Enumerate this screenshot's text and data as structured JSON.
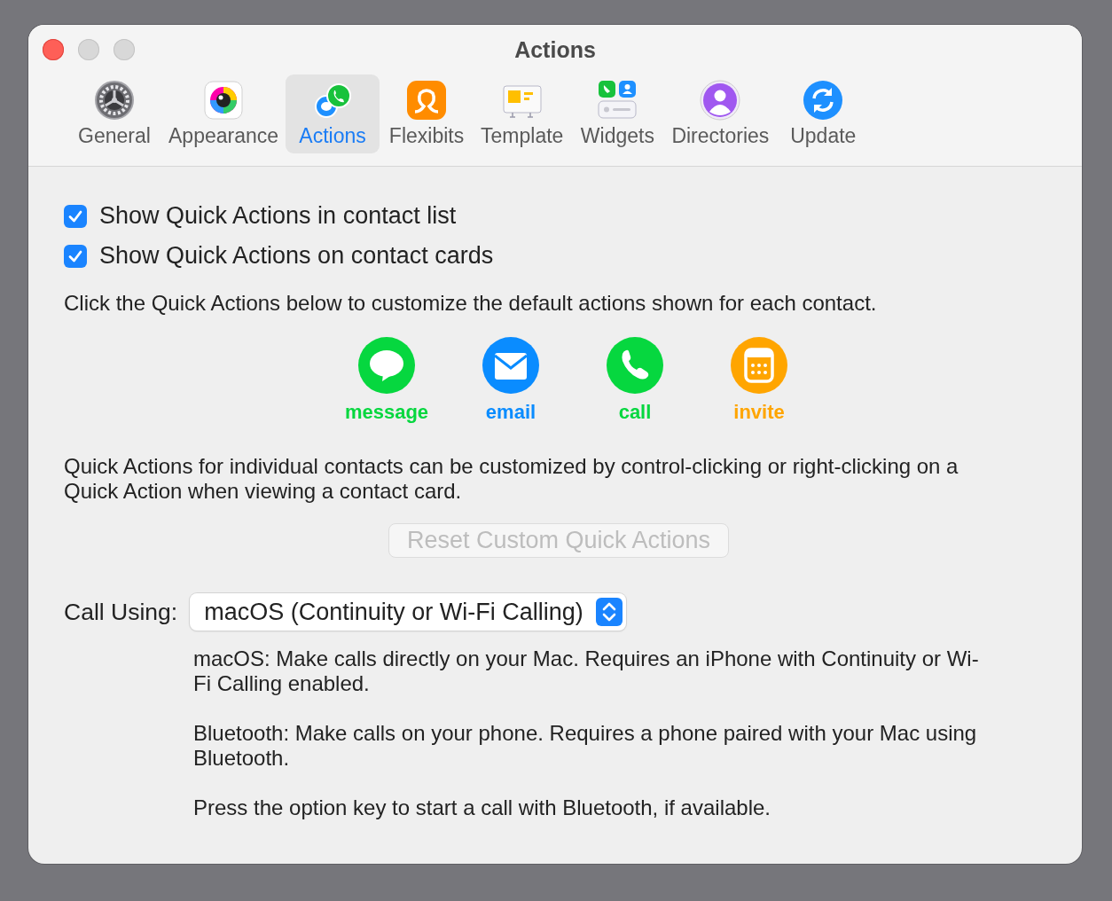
{
  "window": {
    "title": "Actions"
  },
  "tabs": [
    {
      "label": "General",
      "kind": "gear",
      "selected": false
    },
    {
      "label": "Appearance",
      "kind": "palette",
      "selected": false
    },
    {
      "label": "Actions",
      "kind": "actions",
      "selected": true
    },
    {
      "label": "Flexibits",
      "kind": "flexibits",
      "selected": false
    },
    {
      "label": "Template",
      "kind": "template",
      "selected": false
    },
    {
      "label": "Widgets",
      "kind": "widgets",
      "selected": false
    },
    {
      "label": "Directories",
      "kind": "directories",
      "selected": false
    },
    {
      "label": "Update",
      "kind": "update",
      "selected": false
    }
  ],
  "options": [
    {
      "label": "Show Quick Actions in contact list",
      "checked": true
    },
    {
      "label": "Show Quick Actions on contact cards",
      "checked": true
    }
  ],
  "intro": "Click the Quick Actions below to customize the default actions shown for each contact.",
  "quick_actions": [
    {
      "label": "message",
      "kind": "message",
      "color": "#06d73f"
    },
    {
      "label": "email",
      "kind": "email",
      "color": "#0a8cff"
    },
    {
      "label": "call",
      "kind": "call",
      "color": "#06d73f"
    },
    {
      "label": "invite",
      "kind": "invite",
      "color": "#ffa500"
    }
  ],
  "note": "Quick Actions for individual contacts can be customized by control-clicking or right-clicking on a Quick Action when viewing a contact card.",
  "reset_button": {
    "label": "Reset Custom Quick Actions",
    "disabled": true
  },
  "call_using": {
    "label": "Call Using:",
    "value": "macOS (Continuity or Wi-Fi Calling)"
  },
  "descriptions": [
    "macOS: Make calls directly on your Mac. Requires an iPhone with Continuity or Wi-Fi Calling enabled.",
    "Bluetooth: Make calls on your phone. Requires a phone paired with your Mac using Bluetooth.",
    "Press the option key to start a call with Bluetooth, if available."
  ]
}
